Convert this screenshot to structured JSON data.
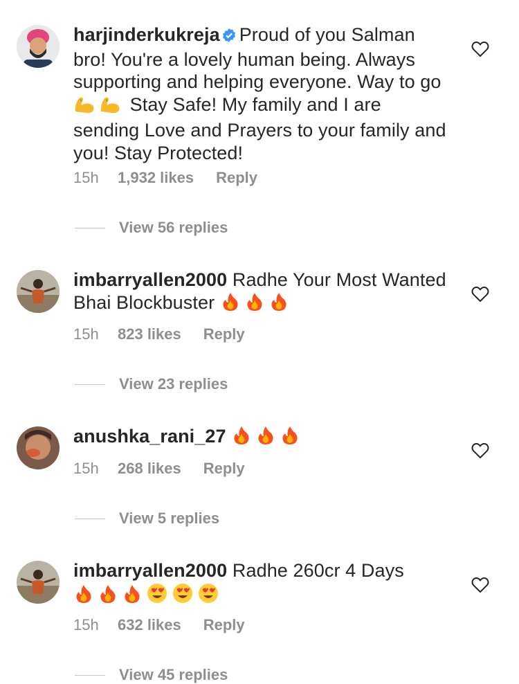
{
  "comments": [
    {
      "username": "harjinderkukreja",
      "verified": true,
      "text1": "Proud of you Salman bro! You're a lovely human being. Always supporting and helping everyone. Way to go",
      "emoji1": [
        "flexed-biceps",
        "flexed-biceps"
      ],
      "text2": "Stay Safe! My family and I are sending Love and Prayers to your family and you! Stay Protected!",
      "time": "15h",
      "likes": "1,932 likes",
      "reply_label": "Reply",
      "view_replies": "View 56 replies"
    },
    {
      "username": "imbarryallen2000",
      "text1": "Radhe Your Most Wanted Bhai Blockbuster",
      "emoji1": [
        "fire",
        "fire",
        "fire"
      ],
      "time": "15h",
      "likes": "823 likes",
      "reply_label": "Reply",
      "view_replies": "View 23 replies"
    },
    {
      "username": "anushka_rani_27",
      "emoji1": [
        "fire",
        "fire",
        "fire"
      ],
      "time": "15h",
      "likes": "268 likes",
      "reply_label": "Reply",
      "view_replies": "View 5 replies"
    },
    {
      "username": "imbarryallen2000",
      "text1": "Radhe 260cr 4 Days",
      "emoji1": [
        "fire",
        "fire",
        "fire",
        "heart-eyes",
        "heart-eyes",
        "heart-eyes"
      ],
      "time": "15h",
      "likes": "632 likes",
      "reply_label": "Reply",
      "view_replies": "View 45 replies"
    }
  ],
  "colors": {
    "text": "#262626",
    "secondary": "#8e8e8e",
    "verified": "#3897f0"
  }
}
